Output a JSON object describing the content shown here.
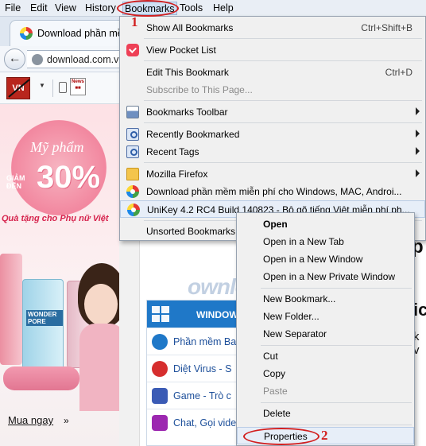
{
  "menubar": {
    "items": [
      {
        "label": "File"
      },
      {
        "label": "Edit"
      },
      {
        "label": "View"
      },
      {
        "label": "History"
      },
      {
        "label": "Bookmarks"
      },
      {
        "label": "Tools"
      },
      {
        "label": "Help"
      }
    ],
    "active": "Bookmarks"
  },
  "tab": {
    "title": "Download phần mề"
  },
  "navbar": {
    "url": "download.com.v"
  },
  "annotations": {
    "step1": "1",
    "step2": "2"
  },
  "bookmarks_menu": {
    "items": [
      {
        "label": "Show All Bookmarks",
        "shortcut": "Ctrl+Shift+B"
      },
      {
        "label": "View Pocket List"
      },
      {
        "label": "Edit This Bookmark",
        "shortcut": "Ctrl+D"
      },
      {
        "label": "Subscribe to This Page..."
      },
      {
        "label": "Bookmarks Toolbar"
      },
      {
        "label": "Recently Bookmarked"
      },
      {
        "label": "Recent Tags"
      },
      {
        "label": "Mozilla Firefox"
      },
      {
        "label": "Download phần mềm miễn phí cho Windows, MAC, Androi..."
      },
      {
        "label": "UniKey 4.2 RC4 Build 140823 - Bộ gõ tiếng Việt miễn phí ph..."
      },
      {
        "label": "Unsorted Bookmarks"
      }
    ]
  },
  "context_menu": {
    "items": [
      {
        "label": "Open"
      },
      {
        "label": "Open in a New Tab"
      },
      {
        "label": "Open in a New Window"
      },
      {
        "label": "Open in a New Private Window"
      },
      {
        "label": "New Bookmark..."
      },
      {
        "label": "New Folder..."
      },
      {
        "label": "New Separator"
      },
      {
        "label": "Cut"
      },
      {
        "label": "Copy"
      },
      {
        "label": "Paste"
      },
      {
        "label": "Delete"
      },
      {
        "label": "Properties"
      }
    ]
  },
  "page": {
    "ad": {
      "headline": "Mỹ phẩm",
      "discount_label_1": "GIẢM",
      "discount_label_2": "ĐẾN",
      "discount": "30%",
      "tagline": "Quà tặng cho Phụ nữ Việt",
      "product_label": "WONDER PORE",
      "cta": "Mua ngay",
      "cta_arrow": "»"
    },
    "watermark": "ownload.com.vn",
    "categories": {
      "header": "WINDOW",
      "items": [
        {
          "label": "Phần mềm Ba"
        },
        {
          "label": "Diệt Virus - S"
        },
        {
          "label": "Game - Trò c"
        },
        {
          "label": "Chat, Gọi vide"
        }
      ]
    },
    "right_edge": {
      "a": "p",
      "b": "ic",
      "c": "k v"
    }
  },
  "colors": {
    "annotation_red": "#d21f1f",
    "menu_bg": "#f0f0f0",
    "highlight": "#e7eef8"
  }
}
